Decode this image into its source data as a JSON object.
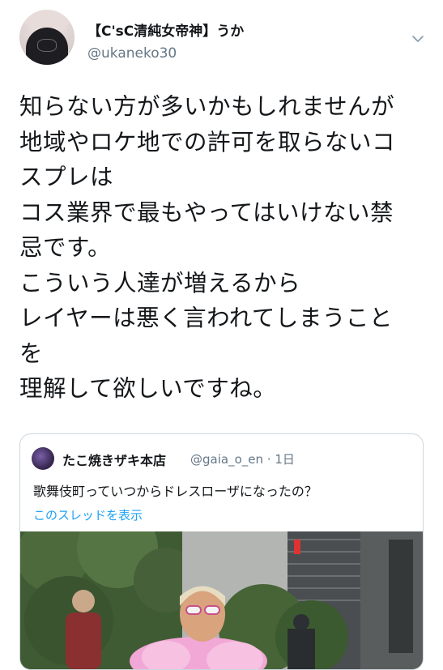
{
  "header": {
    "display_name": "【C'sC清純女帝神】うか",
    "handle": "@ukaneko30",
    "avatar_icon": "user-avatar",
    "menu_icon": "chevron-down-icon"
  },
  "tweet": {
    "lines": [
      "知らない方が多いかもしれませんが",
      "地域やロケ地での許可を取らないコ",
      "スプレは",
      "コス業界で最もやってはいけない禁",
      "忌です。",
      "こういう人達が増えるから",
      "レイヤーは悪く言われてしまうこと",
      "を",
      "理解して欲しいですね。"
    ]
  },
  "quote": {
    "display_name": "たこ焼きザキ本店",
    "handle": "@gaia_o_en",
    "separator": "·",
    "time": "1日",
    "text": "歌舞伎町っていつからドレスローザになったの？",
    "show_thread": "このスレッドを表示",
    "photo_icon": "street-photo"
  },
  "colors": {
    "text": "#14171a",
    "secondary": "#657786",
    "link": "#1da1f2",
    "border": "#ccd6dd"
  }
}
